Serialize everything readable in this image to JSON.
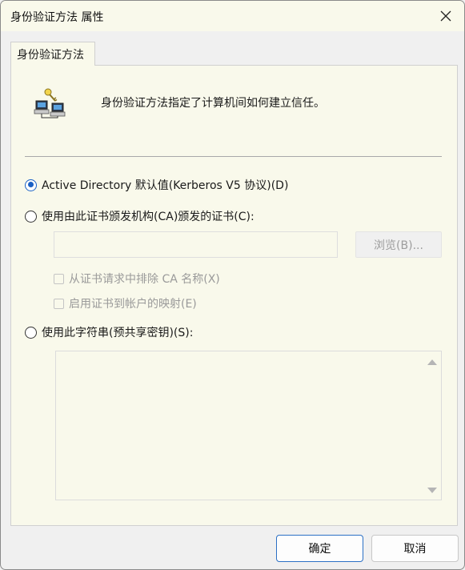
{
  "window": {
    "title": "身份验证方法 属性",
    "close_icon": "close-icon"
  },
  "tab": {
    "label": "身份验证方法"
  },
  "header": {
    "icon": "network-computers-key-icon",
    "description": "身份验证方法指定了计算机间如何建立信任。"
  },
  "options": {
    "kerberos": {
      "label": "Active Directory 默认值(Kerberos V5 协议)(D)",
      "checked": true
    },
    "ca_cert": {
      "label": "使用由此证书颁发机构(CA)颁发的证书(C):",
      "checked": false,
      "input_value": "",
      "browse_label": "浏览(B)...",
      "exclude_ca_label": "从证书请求中排除 CA 名称(X)",
      "enable_mapping_label": "启用证书到帐户的映射(E)"
    },
    "psk": {
      "label": "使用此字符串(预共享密钥)(S):",
      "checked": false,
      "value": ""
    }
  },
  "footer": {
    "ok_label": "确定",
    "cancel_label": "取消"
  },
  "colors": {
    "accent": "#1a60c4",
    "panel_bg": "#f9f9eb",
    "window_bg": "#f0f0f0"
  }
}
